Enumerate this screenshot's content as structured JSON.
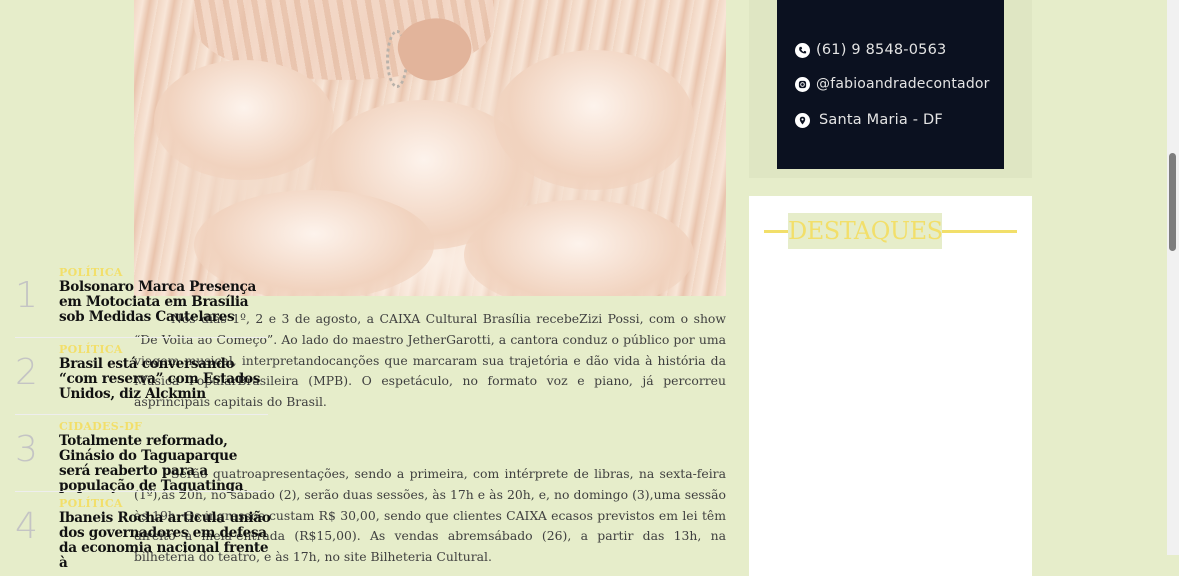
{
  "article": {
    "image_alt": "",
    "paragraph1": "Nos dias 1º, 2 e 3 de agosto, a CAIXA Cultural Brasília recebeZizi Possi, com o show “De Volta ao Começo”. Ao lado do maestro JetherGarotti, a cantora conduz o público por uma viagem musical, interpretandocanções que marcaram sua trajetória e dão vida à história da Música PopularBrasileira (MPB). O espetáculo, no formato voz e piano, já percorreu asprincipais capitais do Brasil.",
    "paragraph2_text": "Serão quatroapresentações, sendo a primeira, com intérprete de libras, na sexta-feira (1º),às 20h, no sábado (2), serão duas sessões, às 17h e às 20h, e, no domingo (3),uma sessão às 19h. Os ingressos custam R$ 30,00, sendo que clientes CAIXA ecasos previstos em lei têm direito à meia-entrada (R$15,00). As vendas abremsábado (26), a partir das 13h, na bilheteria do teatro, e às 17h, no site ",
    "paragraph2_link": "Bilheteria Cultural",
    "paragraph2_end": "."
  },
  "contact": {
    "phone": "(61) 9 8548-0563",
    "instagram": "@fabioandradecontador",
    "location": "Santa Maria - DF",
    "icons": [
      "phone-icon",
      "instagram-icon",
      "location-pin-icon"
    ]
  },
  "highlights": {
    "title": "DESTAQUES",
    "accent_color": "#f2df6a",
    "items": [
      {
        "number": "1",
        "category": "POLÍTICA",
        "headline": "Bolsonaro Marca Presença em Motociata em Brasília sob Medidas Cautelares"
      },
      {
        "number": "2",
        "category": "POLÍTICA",
        "headline": "Brasil está conversando “com reserva” com Estados Unidos, diz Alckmin"
      },
      {
        "number": "3",
        "category": "CIDADES-DF",
        "headline": "Totalmente reformado, Ginásio do Taguaparque será reaberto para a população de Taguatinga"
      },
      {
        "number": "4",
        "category": "POLÍTICA",
        "headline": "Ibaneis Rocha articula união dos governadores em defesa da economia nacional frente à"
      }
    ]
  }
}
